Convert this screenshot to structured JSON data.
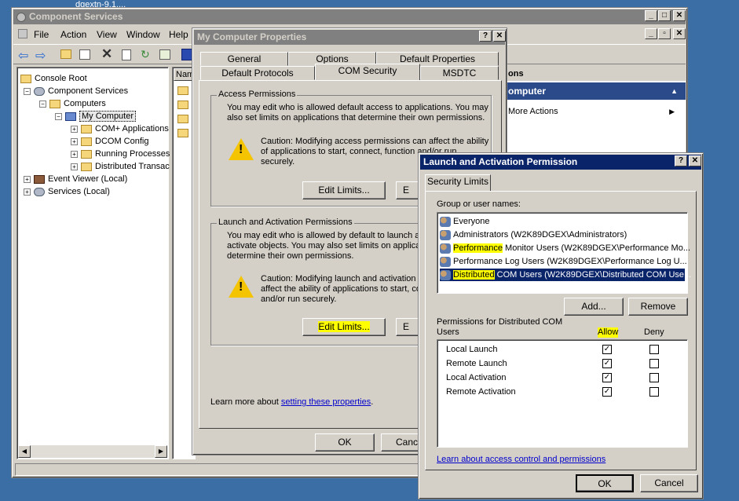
{
  "background_title": "dgextn-9.1....",
  "component_services": {
    "title": "Component Services",
    "menu": [
      "File",
      "Action",
      "View",
      "Window",
      "Help"
    ],
    "tree": [
      {
        "label": "Console Root",
        "indent": 0
      },
      {
        "label": "Component Services",
        "indent": 1
      },
      {
        "label": "Computers",
        "indent": 2
      },
      {
        "label": "My Computer",
        "indent": 3
      },
      {
        "label": "COM+ Applications",
        "indent": 4
      },
      {
        "label": "DCOM Config",
        "indent": 4
      },
      {
        "label": "Running Processes",
        "indent": 4
      },
      {
        "label": "Distributed Transac",
        "indent": 4
      },
      {
        "label": "Event Viewer (Local)",
        "indent": 1
      },
      {
        "label": "Services (Local)",
        "indent": 1
      }
    ],
    "list_header": "Nam",
    "actions_header": "ons",
    "actions_selected": "omputer",
    "more_actions": "More Actions"
  },
  "props_dialog": {
    "title": "My Computer Properties",
    "tabs_row1": [
      "General",
      "Options",
      "Default Properties"
    ],
    "tabs_row2": [
      "Default Protocols",
      "COM Security",
      "MSDTC"
    ],
    "access": {
      "group": "Access Permissions",
      "desc1": "You may edit who is allowed default access to applications. You may",
      "desc2": "also set limits on applications that determine their own permissions.",
      "caution1": "Caution: Modifying access permissions can affect the ability",
      "caution2": "of applications to start, connect, function and/or run",
      "caution3": "securely.",
      "edit_limits": "Edit Limits...",
      "edit_default": "E"
    },
    "launch": {
      "group": "Launch and Activation Permissions",
      "desc1": "You may edit who is allowed by default to launch ap",
      "desc2": "activate objects. You may also set limits on applicati",
      "desc3": "determine their own permissions.",
      "caution1": "Caution: Modifying launch and activation p",
      "caution2": "affect the ability of applications to start, cor",
      "caution3": "and/or run securely.",
      "edit_limits": "Edit Limits...",
      "edit_default": "E"
    },
    "learn_prefix": "Learn more about ",
    "learn_link": "setting these properties",
    "learn_suffix": ".",
    "ok": "OK",
    "cancel": "Cance"
  },
  "launch_dialog": {
    "title": "Launch and Activation Permission",
    "tab": "Security Limits",
    "group_label": "Group or user names:",
    "users": [
      "Everyone",
      "Administrators (W2K89DGEX\\Administrators)",
      "Performance Monitor Users (W2K89DGEX\\Performance Mo...",
      "Performance Log Users (W2K89DGEX\\Performance Log U...",
      "Distributed COM Users (W2K89DGEX\\Distributed COM Use..."
    ],
    "add": "Add...",
    "remove": "Remove",
    "perm_label1": "Permissions for Distributed COM",
    "perm_label2": "Users",
    "allow": "Allow",
    "deny": "Deny",
    "permissions": [
      {
        "name": "Local Launch",
        "allow": true,
        "deny": false
      },
      {
        "name": "Remote Launch",
        "allow": true,
        "deny": false
      },
      {
        "name": "Local Activation",
        "allow": true,
        "deny": false
      },
      {
        "name": "Remote Activation",
        "allow": true,
        "deny": false
      }
    ],
    "learn_link": "Learn about access control and permissions",
    "ok": "OK",
    "cancel": "Cancel"
  }
}
